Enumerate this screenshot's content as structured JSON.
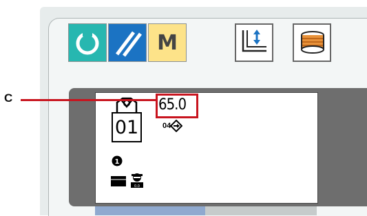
{
  "toolbar": {
    "buttons": [
      {
        "icon": "ready-circle-icon",
        "color": "#27b7b0"
      },
      {
        "icon": "reset-slashes-icon",
        "color": "#1b73c3"
      },
      {
        "icon": "mode-icon",
        "label": "M",
        "color": "#fde389"
      },
      {
        "icon": "presser-foot-lift-icon",
        "color": "#ffffff"
      },
      {
        "icon": "bobbin-winding-icon",
        "color": "#ffffff"
      }
    ]
  },
  "callout": {
    "letter": "C",
    "color": "#c8141e"
  },
  "lcd": {
    "value": "65.0",
    "pattern_number": "01",
    "small_number": "04"
  }
}
